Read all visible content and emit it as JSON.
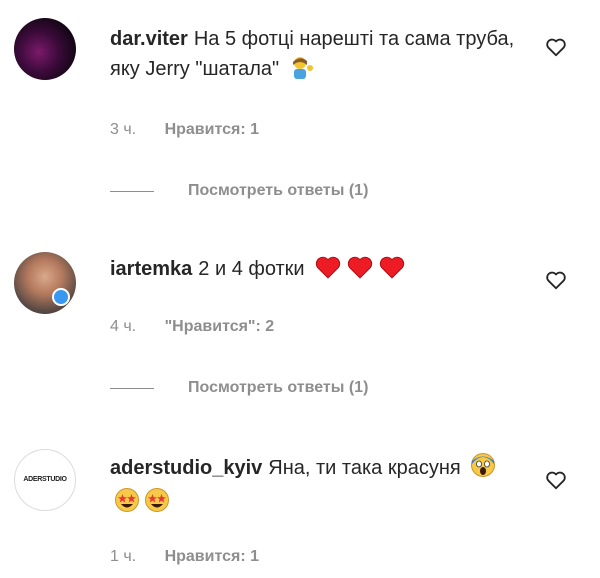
{
  "comments": [
    {
      "username": "dar.viter",
      "text": "На 5 фотці нарешті та сама труба, яку Jerry \"шатала\"",
      "emoji": [
        "person-tipping-hand-icon"
      ],
      "time": "3 ч.",
      "likes": "Нравится: 1",
      "replies": "Посмотреть ответы (1)"
    },
    {
      "username": "iartemka",
      "text": "2 и 4 фотки",
      "emoji": [
        "red-heart-icon",
        "red-heart-icon",
        "red-heart-icon"
      ],
      "time": "4 ч.",
      "likes": "\"Нравится\": 2",
      "replies": "Посмотреть ответы (1)"
    },
    {
      "username": "aderstudio_kyiv",
      "text": "Яна, ти така красуня",
      "emoji": [
        "face-screaming-in-fear-icon",
        "star-struck-icon",
        "star-struck-icon"
      ],
      "time": "1 ч.",
      "likes": "Нравится: 1",
      "avatar_logo": "ADERSTUDIO"
    }
  ],
  "colors": {
    "primary_text": "#262626",
    "secondary_text": "#8e8e8e",
    "heart_red": "#ed1c24"
  }
}
